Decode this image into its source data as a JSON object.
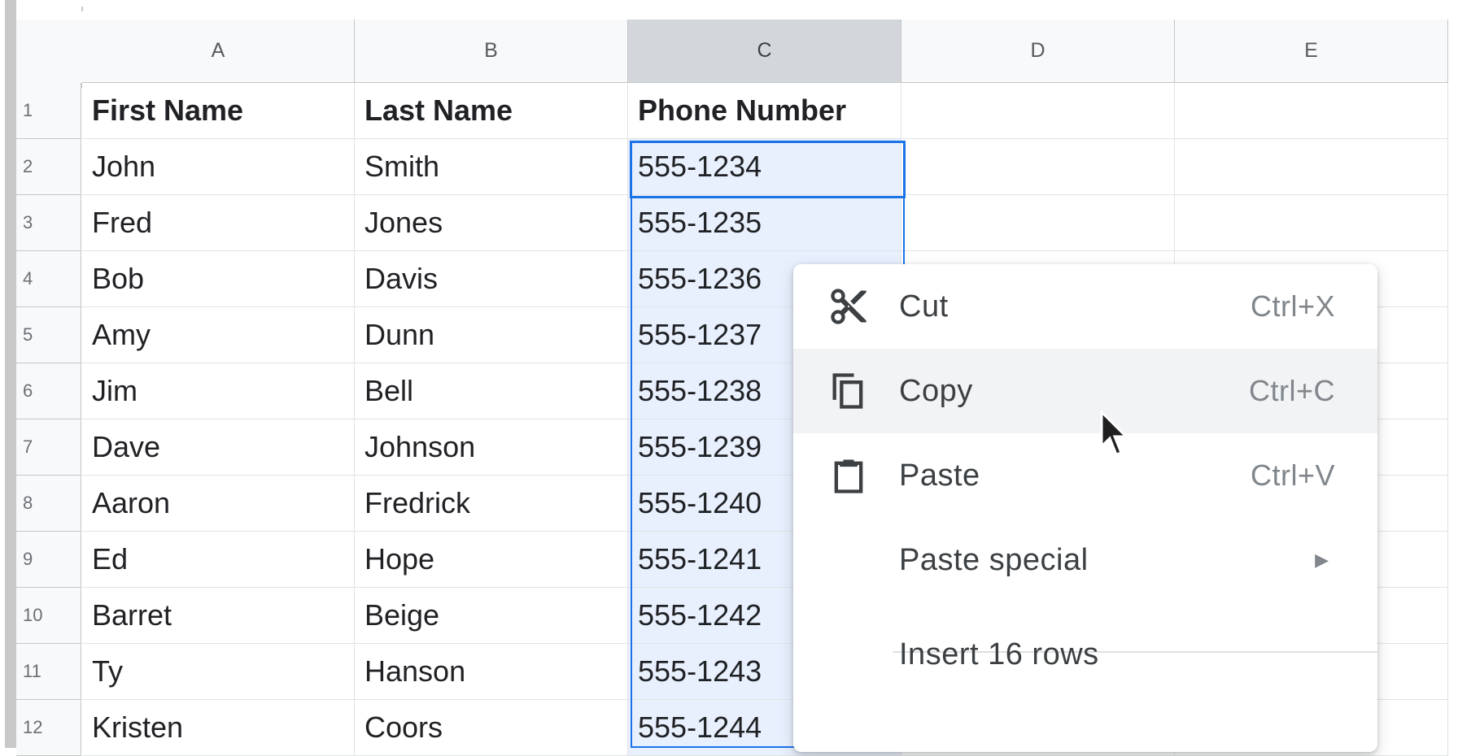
{
  "columns": [
    {
      "label": "A",
      "selected": false
    },
    {
      "label": "B",
      "selected": false
    },
    {
      "label": "C",
      "selected": true
    },
    {
      "label": "D",
      "selected": false
    },
    {
      "label": "E",
      "selected": false
    }
  ],
  "rows": [
    {
      "num": "1",
      "cells": [
        "First Name",
        "Last Name",
        "Phone  Number",
        "",
        ""
      ],
      "header": true
    },
    {
      "num": "2",
      "cells": [
        "John",
        "Smith",
        "555-1234",
        "",
        ""
      ]
    },
    {
      "num": "3",
      "cells": [
        "Fred",
        "Jones",
        "555-1235",
        "",
        ""
      ]
    },
    {
      "num": "4",
      "cells": [
        "Bob",
        "Davis",
        "555-1236",
        "",
        ""
      ]
    },
    {
      "num": "5",
      "cells": [
        "Amy",
        "Dunn",
        "555-1237",
        "",
        ""
      ]
    },
    {
      "num": "6",
      "cells": [
        "Jim",
        "Bell",
        "555-1238",
        "",
        ""
      ]
    },
    {
      "num": "7",
      "cells": [
        "Dave",
        "Johnson",
        "555-1239",
        "",
        ""
      ]
    },
    {
      "num": "8",
      "cells": [
        "Aaron",
        "Fredrick",
        "555-1240",
        "",
        ""
      ]
    },
    {
      "num": "9",
      "cells": [
        "Ed",
        "Hope",
        "555-1241",
        "",
        ""
      ]
    },
    {
      "num": "10",
      "cells": [
        "Barret",
        "Beige",
        "555-1242",
        "",
        ""
      ]
    },
    {
      "num": "11",
      "cells": [
        "Ty",
        "Hanson",
        "555-1243",
        "",
        ""
      ]
    },
    {
      "num": "12",
      "cells": [
        "Kristen",
        "Coors",
        "555-1244",
        "",
        ""
      ]
    }
  ],
  "context_menu": {
    "items": [
      {
        "id": "cut",
        "label": "Cut",
        "shortcut": "Ctrl+X",
        "icon": "scissors-icon"
      },
      {
        "id": "copy",
        "label": "Copy",
        "shortcut": "Ctrl+C",
        "icon": "copy-icon",
        "hovered": true
      },
      {
        "id": "paste",
        "label": "Paste",
        "shortcut": "Ctrl+V",
        "icon": "clipboard-icon"
      },
      {
        "id": "paste-special",
        "label": "Paste special",
        "submenu_arrow": "▶"
      },
      {
        "id": "insert-rows",
        "label": "Insert 16 rows"
      }
    ]
  },
  "colors": {
    "selection_fill": "#e8f0fe",
    "selection_border": "#1a73e8",
    "menu_hover": "#f1f3f4"
  }
}
